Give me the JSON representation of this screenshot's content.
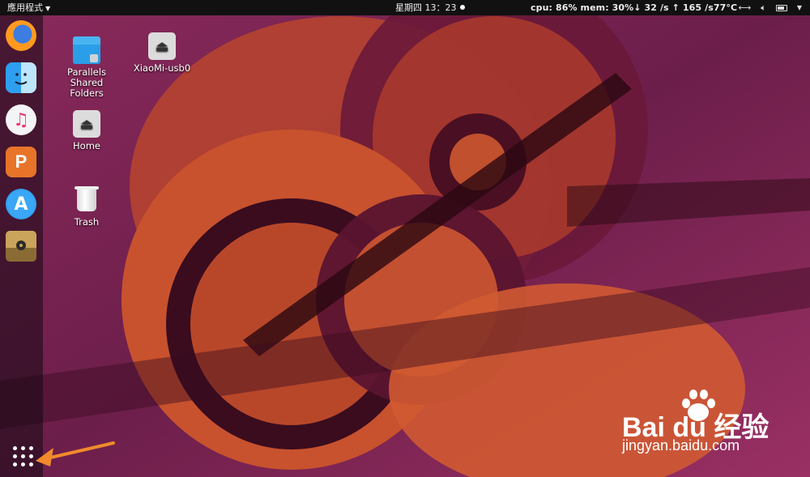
{
  "topbar": {
    "activities_label": "應用程式",
    "clock": "星期四 13：23",
    "system_stats": "cpu: 86% mem: 30%↓  32  /s ↑ 165  /s77°C"
  },
  "dock": {
    "items": [
      {
        "name": "firefox",
        "icon": "firefox-icon"
      },
      {
        "name": "finder",
        "icon": "finder-icon"
      },
      {
        "name": "itunes",
        "icon": "music-icon"
      },
      {
        "name": "wps-presentation",
        "icon": "presentation-icon"
      },
      {
        "name": "app-store",
        "icon": "app-store-icon"
      },
      {
        "name": "removable-drive",
        "icon": "usb-drive-icon"
      }
    ],
    "show_apps_icon": "grid-icon"
  },
  "desktop": {
    "icons": [
      {
        "label": "Parallels Shared Folders",
        "icon": "shared-folder-icon"
      },
      {
        "label": "XiaoMi-usb0",
        "icon": "eject-icon"
      },
      {
        "label": "Home",
        "icon": "eject-icon"
      },
      {
        "label": "Trash",
        "icon": "trash-icon"
      }
    ]
  },
  "colors": {
    "wallpaper_base": "#6b1f4d",
    "wallpaper_orange": "#c8522e",
    "annotation_arrow": "#f08a2c"
  },
  "watermark": {
    "brand": "Bai du 经验",
    "url": "jingyan.baidu.com"
  }
}
